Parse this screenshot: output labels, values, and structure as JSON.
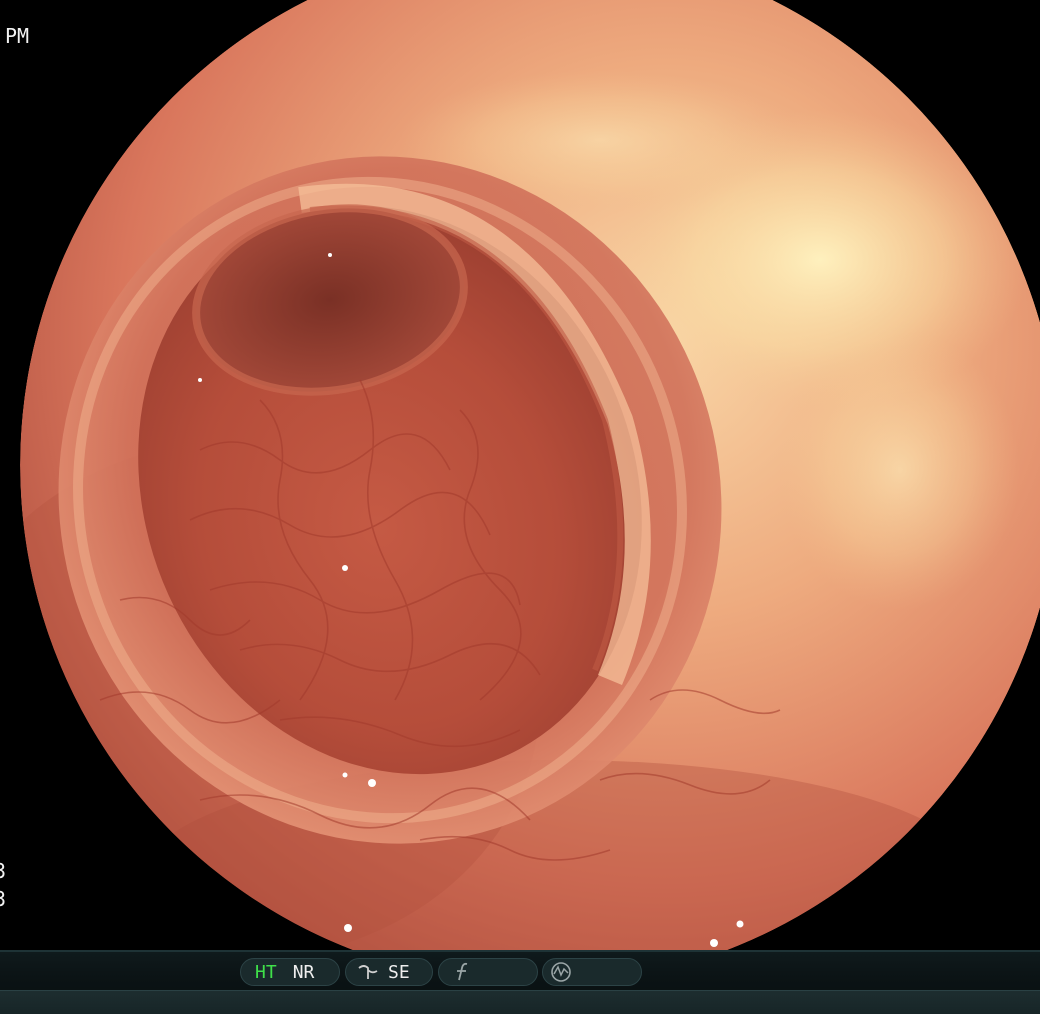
{
  "osd": {
    "time_suffix": "PM",
    "left_line_1": "3",
    "left_line_2": "3"
  },
  "status_bar": {
    "ht_label": "HT",
    "nr_label": "NR",
    "se_label": "SE",
    "ht_active": true,
    "icons": {
      "structure": "structure-enhance-icon",
      "function": "function-f-icon",
      "waveform": "waveform-circle-icon"
    }
  },
  "colors": {
    "mucosa_light": "#f2b98f",
    "mucosa_mid": "#d9765c",
    "mucosa_dark": "#9c3f31",
    "lumen_dark": "#6b2a22",
    "highlight": "#fff0b0",
    "active_green": "#3fe04a"
  }
}
